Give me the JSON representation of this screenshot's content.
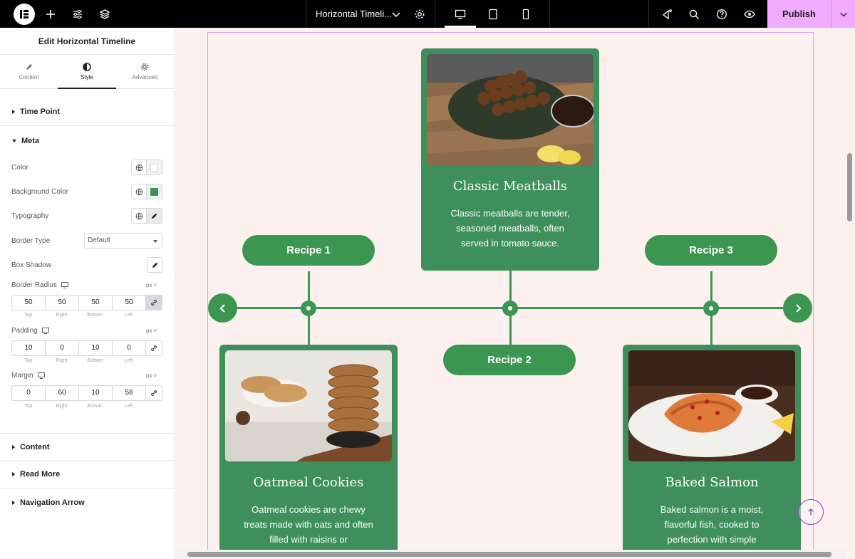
{
  "topbar": {
    "document_title": "Horizontal Timeli...",
    "publish_label": "Publish",
    "accent": "#f0abfc"
  },
  "panel": {
    "title": "Edit Horizontal Timeline",
    "tabs": [
      {
        "label": "Content",
        "icon": "pencil-icon"
      },
      {
        "label": "Style",
        "icon": "contrast-icon",
        "active": true
      },
      {
        "label": "Advanced",
        "icon": "gear-icon"
      }
    ],
    "sections": {
      "time_point": "Time Point",
      "meta": "Meta",
      "content": "Content",
      "read_more": "Read More",
      "navigation_arrow": "Navigation Arrow"
    },
    "meta": {
      "color_label": "Color",
      "color_value": "#ffffff",
      "bg_color_label": "Background Color",
      "bg_color_value": "#3a9650",
      "typography_label": "Typography",
      "border_type_label": "Border Type",
      "border_type_value": "Default",
      "box_shadow_label": "Box Shadow",
      "border_radius_label": "Border Radius",
      "border_radius_unit": "px",
      "border_radius": [
        "50",
        "50",
        "50",
        "50"
      ],
      "padding_label": "Padding",
      "padding_unit": "px",
      "padding": [
        "10",
        "0",
        "10",
        "0"
      ],
      "margin_label": "Margin",
      "margin_unit": "px",
      "margin": [
        "0",
        "60",
        "10",
        "58"
      ],
      "side_labels": [
        "Top",
        "Right",
        "Bottom",
        "Left"
      ]
    }
  },
  "timeline": {
    "accent": "#3a9650",
    "points": [
      {
        "label": "Recipe 1",
        "title": "Oatmeal Cookies",
        "description": "Oatmeal cookies are chewy treats made with oats and often filled with raisins or"
      },
      {
        "label": "Recipe 2",
        "title": "Classic Meatballs",
        "description": "Classic meatballs are tender, seasoned meatballs, often served in tomato sauce."
      },
      {
        "label": "Recipe 3",
        "title": "Baked Salmon",
        "description": "Baked salmon is a moist, flavorful fish, cooked to perfection with simple"
      }
    ]
  }
}
